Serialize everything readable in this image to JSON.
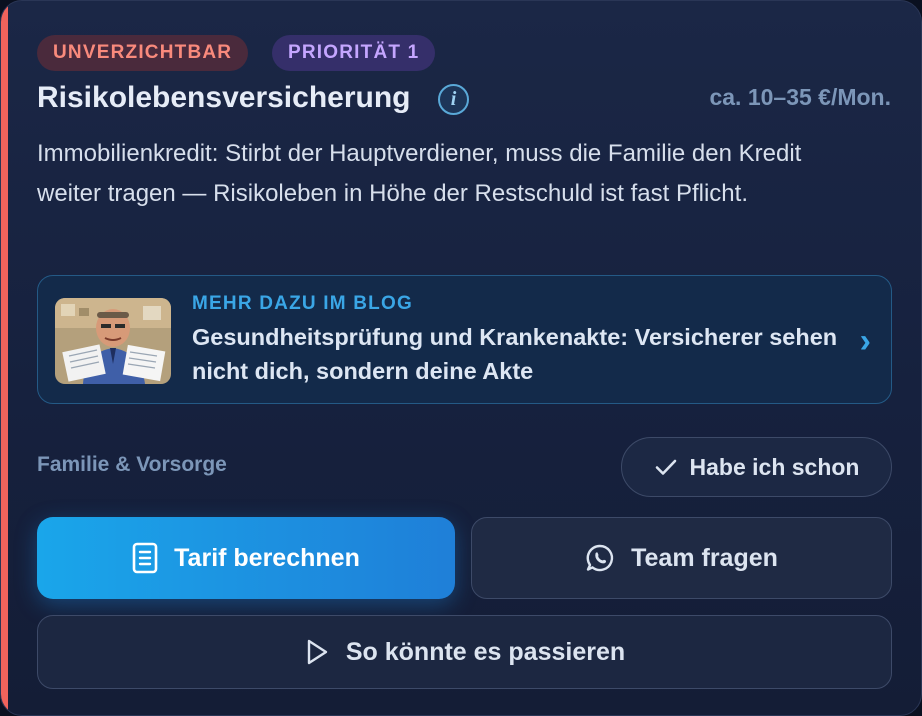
{
  "badges": {
    "importance": "UNVERZICHTBAR",
    "priority": "PRIORITÄT 1"
  },
  "insurance": {
    "title": "Risikolebensversicherung",
    "info_icon": "i",
    "price": "ca. 10–35 €/Mon.",
    "description": "Immobilienkredit: Stirbt der Hauptverdiener, muss die Familie den Kredit weiter tragen — Risikoleben in Höhe der Restschuld ist fast Pflicht."
  },
  "blog": {
    "kicker": "MEHR DAZU IM BLOG",
    "title": "Gesundheitsprüfung und Krankenakte: Versicherer sehen nicht dich, sondern deine Akte",
    "chevron": "›"
  },
  "category": "Familie & Vorsorge",
  "actions": {
    "have_it": "Habe ich schon",
    "calculate": "Tarif berechnen",
    "ask_team": "Team fragen",
    "scenario": "So könnte es passieren"
  },
  "icons": {
    "info": "info-icon",
    "check": "check-icon",
    "calculator": "calculator-icon",
    "whatsapp": "whatsapp-icon",
    "play": "play-icon",
    "chevron": "chevron-right-icon"
  },
  "colors": {
    "accent": "#f0635c",
    "primary": "#1aa6ea",
    "blog_accent": "#3aa6e6",
    "badge_red": "#f98a7c",
    "badge_purple": "#c5a6ff"
  }
}
